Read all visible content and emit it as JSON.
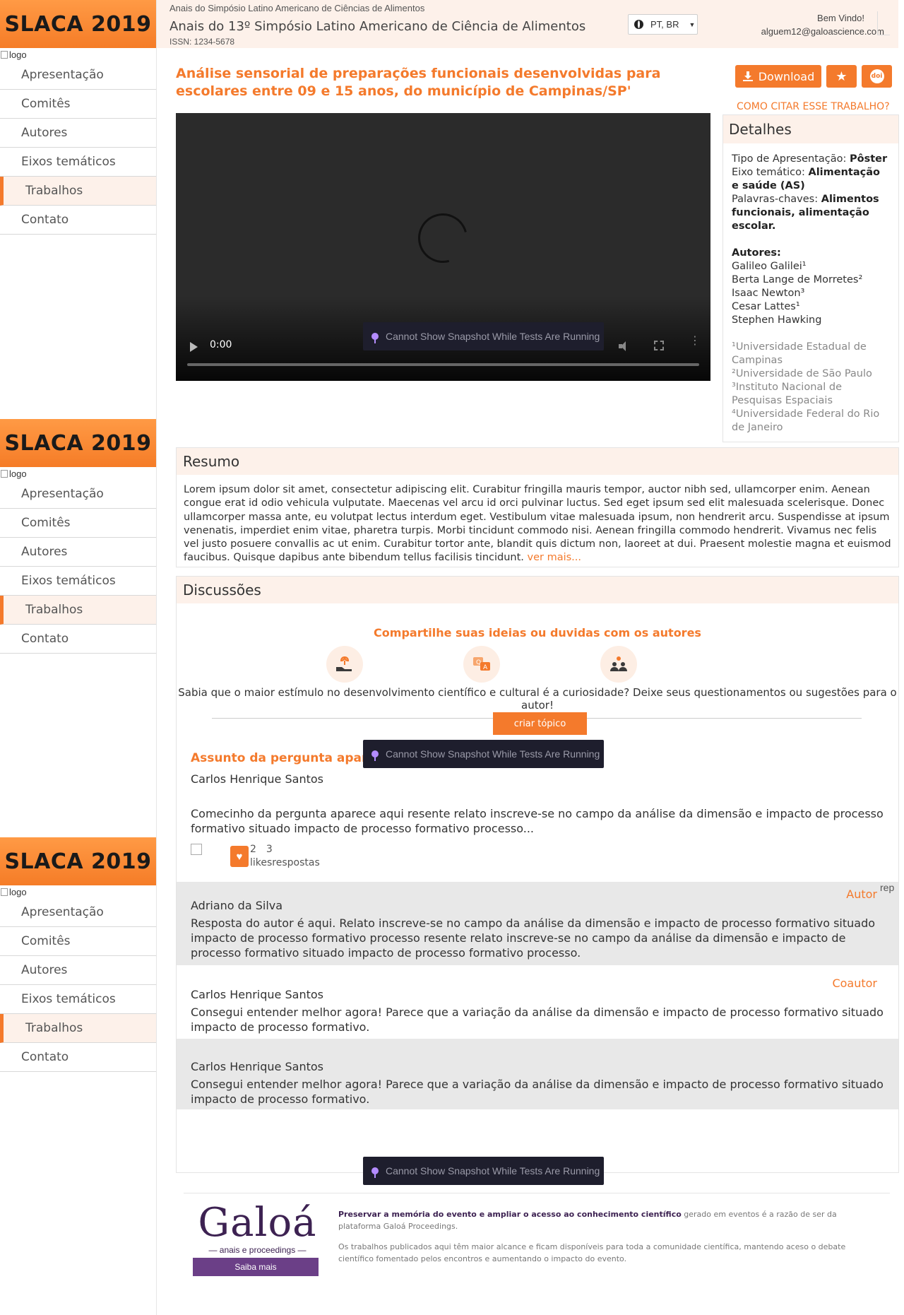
{
  "sidebar": {
    "brand": "SLACA 2019",
    "logo_alt": "logo",
    "items": [
      {
        "label": "Apresentação"
      },
      {
        "label": "Comitês"
      },
      {
        "label": "Autores"
      },
      {
        "label": "Eixos temáticos"
      },
      {
        "label": "Trabalhos",
        "active": true
      },
      {
        "label": "Contato"
      }
    ]
  },
  "header": {
    "sup": "Anais do Simpósio Latino Americano de Ciências de Alimentos",
    "title": "Anais do 13º Simpósio Latino Americano de Ciência de Alimentos",
    "issn": "ISSN: 1234-5678",
    "language": "PT, BR",
    "welcome": "Bem Vindo!",
    "email": "alguem12@galoascience.com"
  },
  "article": {
    "title": "Análise sensorial de preparações funcionais desenvolvidas para escolares entre 09 e 15 anos, do município de Campinas/SP'",
    "download_label": "Download",
    "doi_label": "doi",
    "cite_label": "COMO CITAR ESSE TRABALHO?"
  },
  "video": {
    "time": "0:00",
    "toast": "Cannot Show Snapshot While Tests Are Running"
  },
  "details": {
    "heading": "Detalhes",
    "tipo_label": "Tipo de Apresentação: ",
    "tipo_value": "Pôster",
    "eixo_label": "Eixo temático: ",
    "eixo_value": "Alimentação e saúde (AS)",
    "palavras_label": "Palavras-chaves: ",
    "palavras_value": "Alimentos funcionais, alimentação escolar.",
    "autores_label": "Autores:",
    "autores": [
      "Galileo Galilei¹",
      "Berta Lange de Morretes²",
      "Isaac Newton³",
      "Cesar Lattes¹",
      "Stephen Hawking"
    ],
    "instituicoes": [
      "¹Universidade Estadual de Campinas",
      "²Universidade de São Paulo",
      "³Instituto Nacional de Pesquisas Espaciais",
      "⁴Universidade Federal do Rio de Janeiro"
    ]
  },
  "resumo": {
    "heading": "Resumo",
    "text": "Lorem ipsum dolor sit amet, consectetur adipiscing elit. Curabitur fringilla mauris tempor, auctor nibh sed, ullamcorper enim. Aenean congue erat id odio vehicula vulputate. Maecenas vel arcu id orci pulvinar luctus. Sed eget ipsum sed elit malesuada scelerisque. Donec ullamcorper massa ante, eu volutpat lectus interdum eget. Vestibulum vitae malesuada ipsum, non hendrerit arcu. Suspendisse at ipsum venenatis, imperdiet enim vitae, pharetra turpis. Morbi tincidunt commodo nisi. Aenean fringilla commodo hendrerit. Vivamus nec felis vel justo posuere convallis ac ut enim. Curabitur tortor ante, blandit quis dictum non, laoreet at dui. Praesent molestie magna et euismod faucibus. Quisque dapibus ante bibendum tellus facilisis tincidunt.",
    "more": "ver mais..."
  },
  "discussoes": {
    "heading": "Discussões",
    "share_title": "Compartilhe suas ideias ou duvidas com os autores",
    "subtitle": "Sabia que o maior estímulo no desenvolvimento científico e cultural é a curiosidade? Deixe seus questionamentos ou sugestões para o autor!",
    "create_topic": "criar tópico",
    "question": {
      "title": "Assunto da pergunta aparece aqui",
      "author": "Carlos Henrique Santos",
      "text": "Comecinho da pergunta aparece aqui resente relato inscreve-se no campo da análise da dimensão e impacto de processo formativo situado impacto de processo formativo processo...",
      "likes_count": "2",
      "replies_count": "3",
      "likes_label": "likes",
      "replies_label": "respostas"
    },
    "replies": [
      {
        "author": "Adriano da Silva",
        "role": "Autor",
        "reply_alt": "rep",
        "text": "Resposta do autor é aqui. Relato inscreve-se no campo da análise da dimensão e impacto de processo formativo situado impacto de processo formativo processo resente relato inscreve-se no campo da análise da dimensão e impacto de processo formativo situado impacto de processo formativo processo."
      },
      {
        "author": "Carlos Henrique Santos",
        "role": "Coautor",
        "text": "Consegui entender melhor agora! Parece que a variação da análise da dimensão e impacto de processo formativo situado impacto de processo formativo."
      },
      {
        "author": "Carlos Henrique Santos",
        "role": "",
        "text": "Consegui entender melhor agora! Parece que a variação da análise da dimensão e impacto de processo formativo situado impacto de processo formativo."
      }
    ]
  },
  "footer": {
    "brand": "Galoá",
    "tagline": "anais e proceedings",
    "saiba": "Saiba mais",
    "p1_bold": "Preservar a memória do evento e ampliar o acesso ao conhecimento científico",
    "p1_rest": " gerado em eventos é a razão de ser da plataforma Galoá Proceedings.",
    "p2": "Os trabalhos publicados aqui têm maior alcance e ficam disponíveis para toda a comunidade científica, mantendo aceso o debate científico fomentado pelos encontros e aumentando o impacto do evento."
  }
}
